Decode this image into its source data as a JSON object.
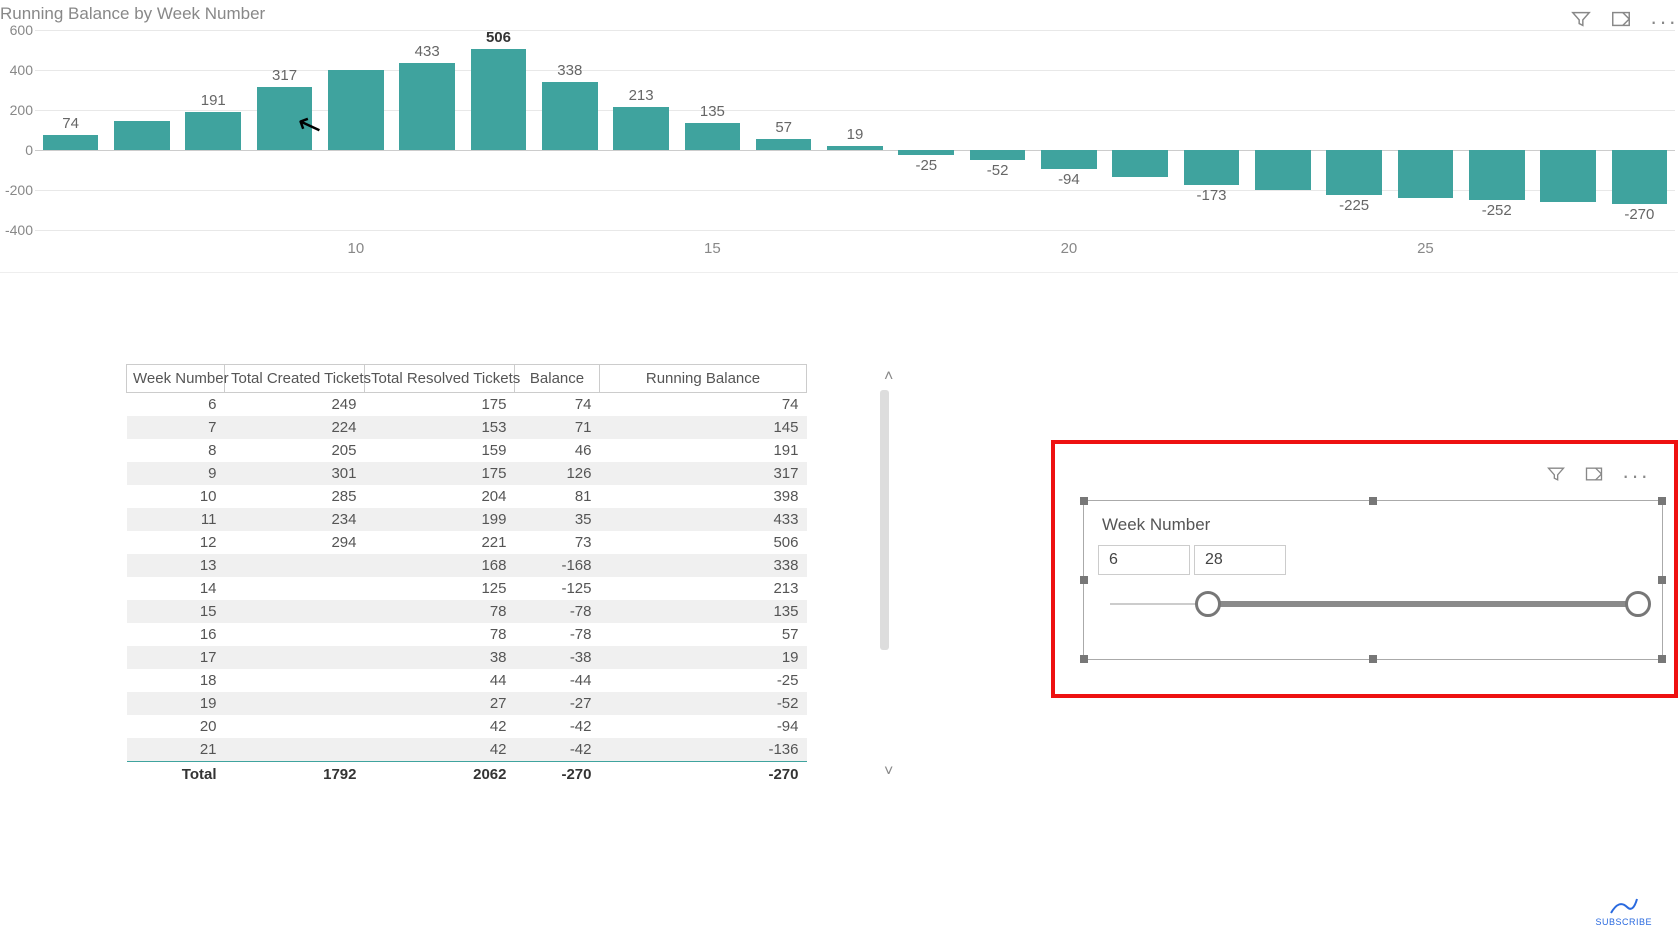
{
  "chart": {
    "title": "Running Balance by Week Number",
    "y_ticks": [
      600,
      400,
      200,
      0,
      -200,
      -400
    ],
    "x_ticks": [
      10,
      15,
      20,
      25
    ],
    "highlighted_value": 506
  },
  "chart_data": {
    "type": "bar",
    "title": "Running Balance by Week Number",
    "xlabel": "Week Number",
    "ylabel": "Running Balance",
    "ylim": [
      -400,
      600
    ],
    "categories": [
      6,
      7,
      8,
      9,
      10,
      11,
      12,
      13,
      14,
      15,
      16,
      17,
      18,
      19,
      20,
      21,
      22,
      23,
      24,
      25,
      26,
      27,
      28
    ],
    "values": [
      74,
      145,
      191,
      317,
      398,
      433,
      506,
      338,
      213,
      135,
      57,
      19,
      -25,
      -52,
      -94,
      -136,
      -173,
      -200,
      -225,
      -238,
      -252,
      -260,
      -270
    ],
    "label_every": [
      74,
      null,
      191,
      317,
      null,
      433,
      506,
      338,
      213,
      135,
      57,
      19,
      -25,
      -52,
      -94,
      null,
      -173,
      null,
      -225,
      null,
      -252,
      null,
      -270
    ]
  },
  "table": {
    "columns": [
      "Week Number",
      "Total Created Tickets",
      "Total Resolved Tickets",
      "Balance",
      "Running Balance"
    ],
    "rows": [
      [
        6,
        249,
        175,
        74,
        74
      ],
      [
        7,
        224,
        153,
        71,
        145
      ],
      [
        8,
        205,
        159,
        46,
        191
      ],
      [
        9,
        301,
        175,
        126,
        317
      ],
      [
        10,
        285,
        204,
        81,
        398
      ],
      [
        11,
        234,
        199,
        35,
        433
      ],
      [
        12,
        294,
        221,
        73,
        506
      ],
      [
        13,
        null,
        168,
        -168,
        338
      ],
      [
        14,
        null,
        125,
        -125,
        213
      ],
      [
        15,
        null,
        78,
        -78,
        135
      ],
      [
        16,
        null,
        78,
        -78,
        57
      ],
      [
        17,
        null,
        38,
        -38,
        19
      ],
      [
        18,
        null,
        44,
        -44,
        -25
      ],
      [
        19,
        null,
        27,
        -27,
        -52
      ],
      [
        20,
        null,
        42,
        -42,
        -94
      ],
      [
        21,
        null,
        42,
        -42,
        -136
      ]
    ],
    "total_label": "Total",
    "totals": [
      1792,
      2062,
      -270,
      -270
    ]
  },
  "slicer": {
    "title": "Week Number",
    "min": 6,
    "max": 28,
    "range_absolute_min": 1,
    "range_absolute_max": 28
  },
  "watermark": {
    "label": "SUBSCRIBE"
  }
}
